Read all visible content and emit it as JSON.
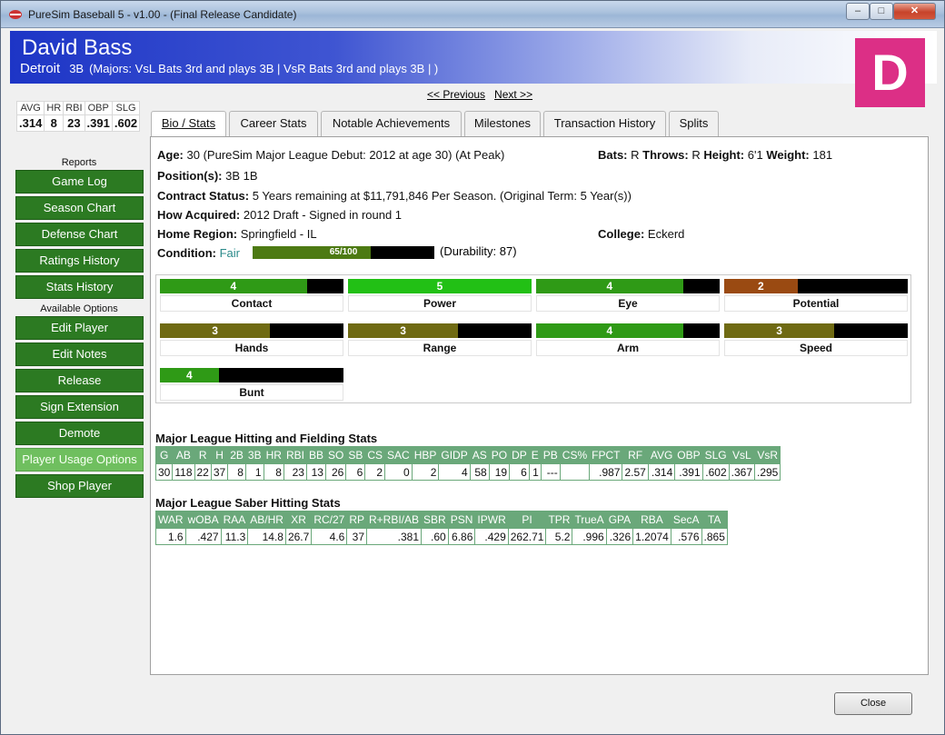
{
  "window": {
    "title": "PureSim Baseball 5 - v1.00 - (Final Release Candidate)",
    "minimize": "–",
    "maximize": "□",
    "close": "✕"
  },
  "player": {
    "name": "David Bass",
    "team": "Detroit",
    "position": "3B",
    "roles": "(Majors: VsL Bats 3rd and plays 3B | VsR Bats 3rd and plays 3B | )",
    "grade": "D",
    "grade_color": "#dc2f86"
  },
  "mini_stats": {
    "headers": [
      "AVG",
      "HR",
      "RBI",
      "OBP",
      "SLG"
    ],
    "values": [
      ".314",
      "8",
      "23",
      ".391",
      ".602"
    ]
  },
  "sidebar": {
    "reports_label": "Reports",
    "reports": [
      "Game Log",
      "Season Chart",
      "Defense Chart",
      "Ratings History",
      "Stats History"
    ],
    "options_label": "Available Options",
    "options": [
      "Edit Player",
      "Edit Notes",
      "Release",
      "Sign Extension",
      "Demote",
      "Player Usage Options",
      "Shop Player"
    ]
  },
  "nav": {
    "previous": "<< Previous",
    "next": "Next >>"
  },
  "tabs": [
    "Bio / Stats",
    "Career Stats",
    "Notable Achievements",
    "Milestones",
    "Transaction History",
    "Splits"
  ],
  "bio": {
    "age_label": "Age:",
    "age_value": "30  (PureSim Major League Debut: 2012 at age 30) (At Peak)",
    "bats_label": "Bats:",
    "bats_value": "R",
    "throws_label": "Throws:",
    "throws_value": "R",
    "height_label": "Height:",
    "height_value": "6'1",
    "weight_label": "Weight:",
    "weight_value": "181",
    "positions_label": "Position(s):",
    "positions_value": "3B 1B",
    "contract_label": "Contract Status:",
    "contract_value": "5 Years remaining at $11,791,846 Per Season. (Original Term: 5 Year(s))",
    "acquired_label": "How Acquired:",
    "acquired_value": "2012 Draft - Signed in round 1",
    "region_label": "Home Region:",
    "region_value": "Springfield -  IL",
    "college_label": "College:",
    "college_value": "Eckerd",
    "condition_label": "Condition:",
    "condition_value": "Fair",
    "condition_bar_text": "65/100",
    "condition_pct": 0.65,
    "durability": "(Durability: 87)"
  },
  "ratings": [
    {
      "label": "Contact",
      "value": "4",
      "fill": 0.8,
      "color": "#2f9a16"
    },
    {
      "label": "Power",
      "value": "5",
      "fill": 1.0,
      "color": "#22c015"
    },
    {
      "label": "Eye",
      "value": "4",
      "fill": 0.8,
      "color": "#2f9a16"
    },
    {
      "label": "Potential",
      "value": "2",
      "fill": 0.4,
      "color": "#9a4a12"
    },
    {
      "label": "Hands",
      "value": "3",
      "fill": 0.6,
      "color": "#6f6a13"
    },
    {
      "label": "Range",
      "value": "3",
      "fill": 0.6,
      "color": "#6f6a13"
    },
    {
      "label": "Arm",
      "value": "4",
      "fill": 0.8,
      "color": "#2f9a16"
    },
    {
      "label": "Speed",
      "value": "3",
      "fill": 0.6,
      "color": "#6f6a13"
    },
    {
      "label": "Bunt",
      "value": "4",
      "fill": 0.32,
      "color": "#2f9a16"
    }
  ],
  "hitting": {
    "title": "Major League Hitting and Fielding Stats",
    "headers": [
      "G",
      "AB",
      "R",
      "H",
      "2B",
      "3B",
      "HR",
      "RBI",
      "BB",
      "SO",
      "SB",
      "CS",
      "SAC",
      "HBP",
      "GIDP",
      "AS",
      "PO",
      "DP",
      "E",
      "PB",
      "CS%",
      "FPCT",
      "RF",
      "AVG",
      "OBP",
      "SLG",
      "VsL",
      "VsR"
    ],
    "values": [
      "30",
      "118",
      "22",
      "37",
      "8",
      "1",
      "8",
      "23",
      "13",
      "26",
      "6",
      "2",
      "0",
      "2",
      "4",
      "58",
      "19",
      "6",
      "1",
      "---",
      "",
      ".987",
      "2.57",
      ".314",
      ".391",
      ".602",
      ".367",
      ".295"
    ]
  },
  "saber": {
    "title": "Major League Saber Hitting Stats",
    "headers": [
      "WAR",
      "wOBA",
      "RAA",
      "AB/HR",
      "XR",
      "RC/27",
      "RP",
      "R+RBI/AB",
      "SBR",
      "PSN",
      "IPWR",
      "PI",
      "TPR",
      "TrueA",
      "GPA",
      "RBA",
      "SecA",
      "TA"
    ],
    "values": [
      "1.6",
      ".427",
      "11.3",
      "14.8",
      "26.7",
      "4.6",
      "37",
      ".381",
      ".60",
      "6.86",
      ".429",
      "262.71",
      "5.2",
      ".996",
      ".326",
      "1.2074",
      ".576",
      ".865"
    ]
  },
  "footer": {
    "close_label": "Close"
  }
}
